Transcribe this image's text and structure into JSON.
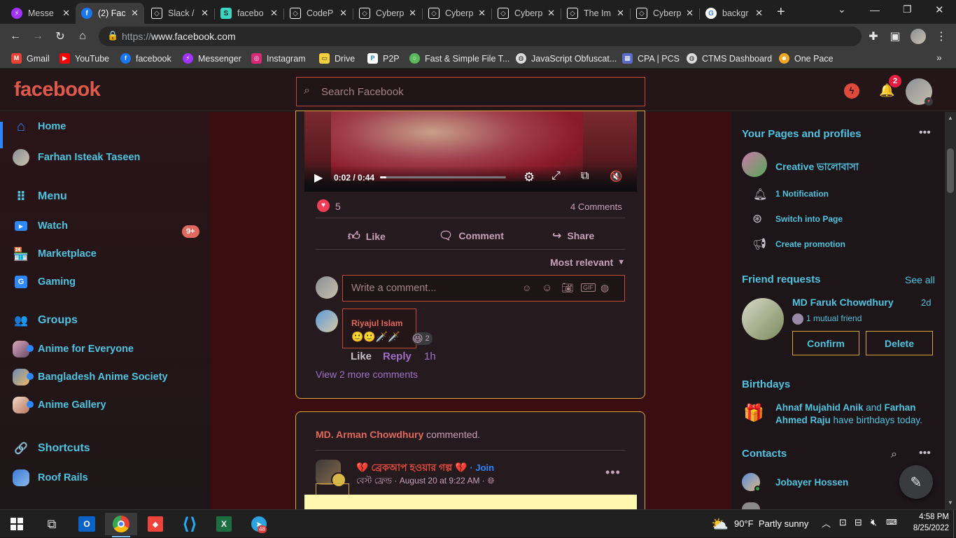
{
  "browser": {
    "tabs": [
      {
        "label": "Messe",
        "icon": "messenger-icon",
        "color": "#a033ff"
      },
      {
        "label": "(2) Fac",
        "icon": "facebook-icon",
        "color": "#1877f2"
      },
      {
        "label": "Slack /",
        "icon": "codepen-icon",
        "color": "#ffffff"
      },
      {
        "label": "facebo",
        "icon": "stackblitz-icon",
        "color": "#3cd5c0"
      },
      {
        "label": "CodeP",
        "icon": "codepen-icon",
        "color": "#ffffff"
      },
      {
        "label": "Cyberp",
        "icon": "codepen-icon",
        "color": "#ffffff"
      },
      {
        "label": "Cyberp",
        "icon": "codepen-icon",
        "color": "#ffffff"
      },
      {
        "label": "Cyberp",
        "icon": "codepen-icon",
        "color": "#ffffff"
      },
      {
        "label": "The Im",
        "icon": "codepen-icon",
        "color": "#ffffff"
      },
      {
        "label": "Cyberp",
        "icon": "codepen-icon",
        "color": "#ffffff"
      },
      {
        "label": "backgr",
        "icon": "google-icon",
        "color": "#4285f4"
      }
    ],
    "url_scheme": "https://",
    "url_host": "www.facebook.com",
    "bookmarks": [
      {
        "label": "Gmail",
        "color": "#ea4335"
      },
      {
        "label": "YouTube",
        "color": "#ff0000"
      },
      {
        "label": "facebook",
        "color": "#1877f2"
      },
      {
        "label": "Messenger",
        "color": "#a033ff"
      },
      {
        "label": "Instagram",
        "color": "#d62976"
      },
      {
        "label": "Drive",
        "color": "#f4d03f"
      },
      {
        "label": "P2P",
        "color": "#2d7dd2"
      },
      {
        "label": "Fast & Simple File T...",
        "color": "#5cb85c"
      },
      {
        "label": "JavaScript Obfuscat...",
        "color": "#888888"
      },
      {
        "label": "CPA | PCS",
        "color": "#5a6cc8"
      },
      {
        "label": "CTMS Dashboard",
        "color": "#888888"
      },
      {
        "label": "One Pace",
        "color": "#f5a623"
      }
    ]
  },
  "header": {
    "logo": "facebook",
    "search_placeholder": "Search Facebook",
    "notification_count": "2"
  },
  "sidebar": {
    "home": "Home",
    "profile": "Farhan Isteak Taseen",
    "menu_title": "Menu",
    "watch": "Watch",
    "watch_badge": "9+",
    "marketplace": "Marketplace",
    "gaming": "Gaming",
    "groups_title": "Groups",
    "groups": [
      "Anime for Everyone",
      "Bangladesh Anime Society",
      "Anime Gallery"
    ],
    "shortcuts_title": "Shortcuts",
    "shortcuts": [
      "Roof Rails"
    ]
  },
  "post1": {
    "video_time": "0:02 / 0:44",
    "video_progress": 0.05,
    "reaction_count": "5",
    "comments_count": "4 Comments",
    "like": "Like",
    "comment": "Comment",
    "share": "Share",
    "sort": "Most relevant",
    "write_placeholder": "Write a comment...",
    "comment_author": "Riyajul Islam",
    "comment_text": "🙂🙂🗡️🗡️",
    "comment_reaction_count": "2",
    "comment_like": "Like",
    "comment_reply": "Reply",
    "comment_time": "1h",
    "view_more": "View 2 more comments"
  },
  "post2": {
    "commenter": "MD. Arman Chowdhury",
    "action": "commented.",
    "group_title": "💔 ব্রেকআপ হওয়ার গল্প 💔",
    "join": "· Join",
    "subtitle": "বেস্ট ফ্রেন্ড · August 20 at 9:22 AM ·"
  },
  "right": {
    "pages_title": "Your Pages and profiles",
    "page_name": "Creative ভালোবাসা",
    "notifications": "1 Notification",
    "switch": "Switch into Page",
    "promotion": "Create promotion",
    "friend_title": "Friend requests",
    "see_all": "See all",
    "friend_name": "MD Faruk Chowdhury",
    "friend_time": "2d",
    "mutual": "1 mutual friend",
    "confirm": "Confirm",
    "delete": "Delete",
    "birthdays_title": "Birthdays",
    "birthday_name1": "Ahnaf Mujahid Anik",
    "birthday_and": " and ",
    "birthday_name2": "Farhan Ahmed Raju",
    "birthday_suffix": " have birthdays today.",
    "contacts_title": "Contacts",
    "contact1": "Jobayer Hossen"
  },
  "taskbar": {
    "weather": "90°F  Partly sunny",
    "time": "4:58 PM",
    "date": "8/25/2022",
    "telegram_badge": "48"
  }
}
